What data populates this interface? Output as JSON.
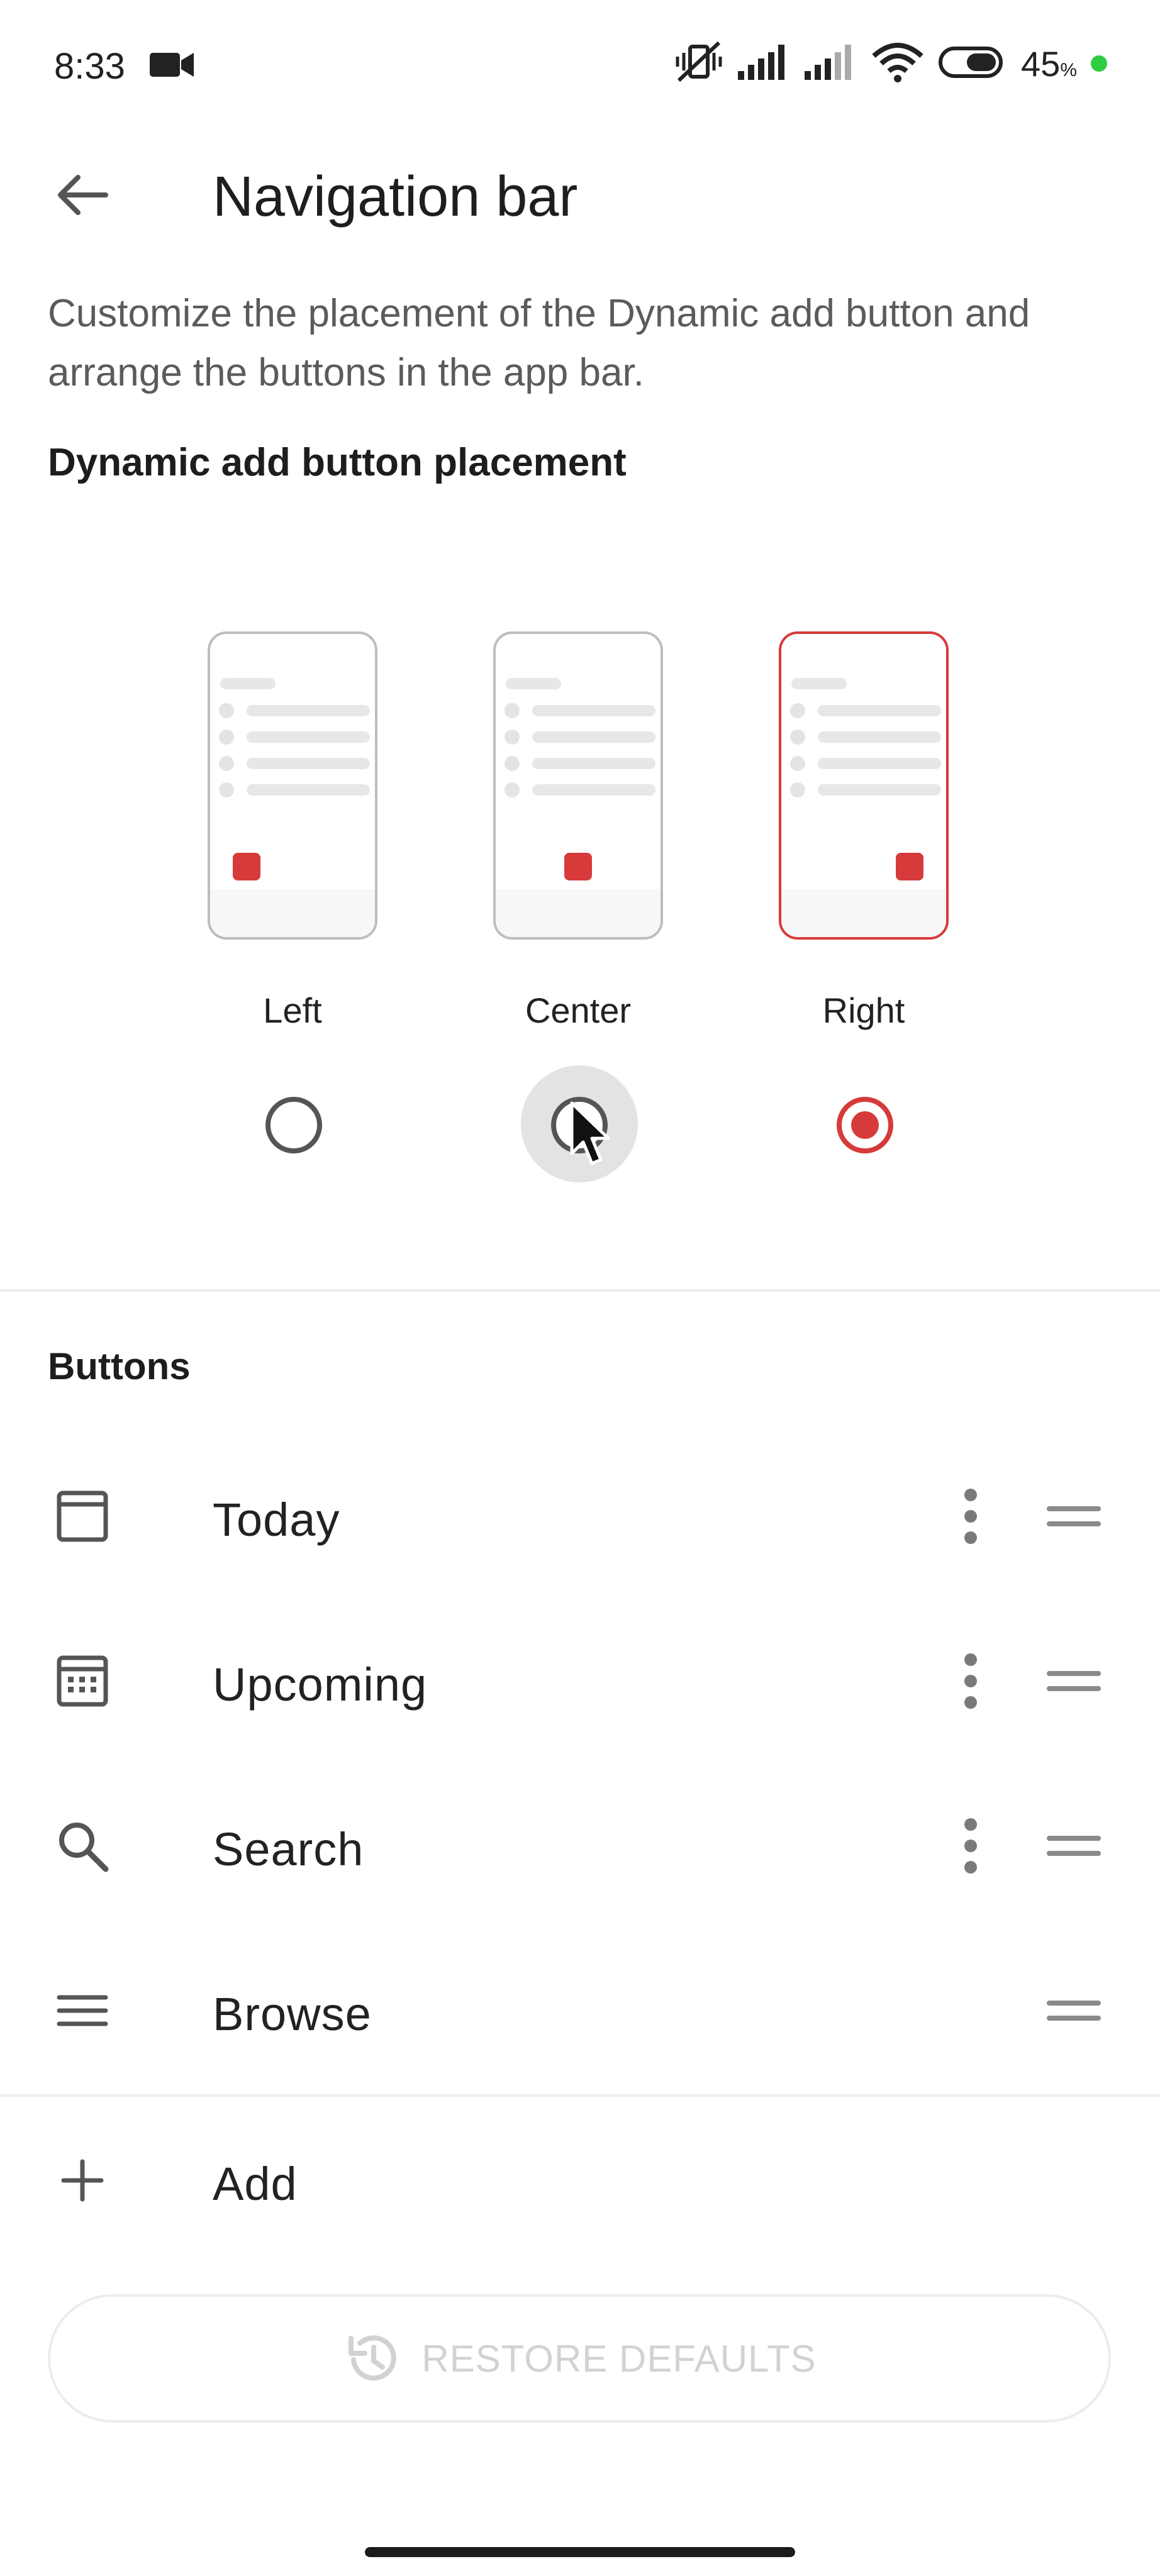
{
  "status_bar": {
    "time": "8:33",
    "battery_percent": "45",
    "battery_percent_sign": "%",
    "icons": [
      "video-camera-icon",
      "vibrate-silent-icon",
      "signal-icon",
      "signal-icon-2",
      "wifi-icon",
      "battery-icon"
    ]
  },
  "header": {
    "title": "Navigation bar",
    "back_icon": "arrow-left-icon"
  },
  "description": "Customize the placement of the Dynamic add button and arrange the buttons in the app bar.",
  "placement_section": {
    "title": "Dynamic add button placement",
    "options": [
      {
        "label": "Left",
        "selected": false
      },
      {
        "label": "Center",
        "selected": false
      },
      {
        "label": "Right",
        "selected": true
      }
    ]
  },
  "buttons_section": {
    "title": "Buttons",
    "items": [
      {
        "label": "Today",
        "icon": "today-icon",
        "has_more_menu": true
      },
      {
        "label": "Upcoming",
        "icon": "calendar-icon",
        "has_more_menu": true
      },
      {
        "label": "Search",
        "icon": "search-icon",
        "has_more_menu": true
      },
      {
        "label": "Browse",
        "icon": "menu-icon",
        "has_more_menu": false
      }
    ],
    "add_label": "Add"
  },
  "restore_button": {
    "label": "RESTORE DEFAULTS",
    "icon": "history-icon",
    "enabled": false
  },
  "colors": {
    "accent": "#d63a3a",
    "text_primary": "#202020",
    "text_secondary": "#5b5b5b",
    "disabled": "#d2d2d2",
    "status_dot": "#2ecc40"
  }
}
